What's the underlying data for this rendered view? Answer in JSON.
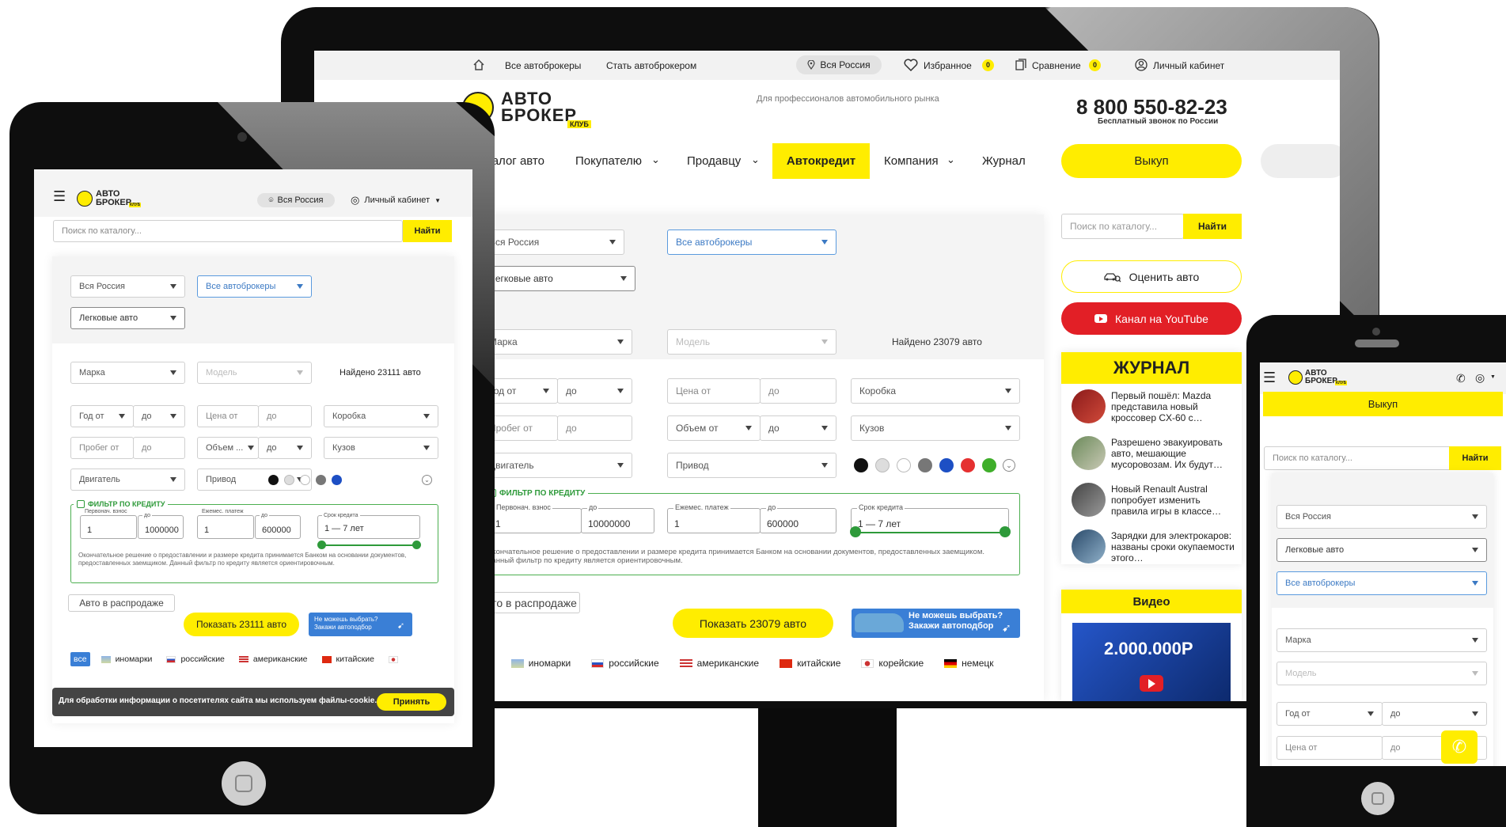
{
  "desktop": {
    "topbar": {
      "all_brokers": "Все автоброкеры",
      "become_broker": "Стать автоброкером",
      "region": "Вся Россия",
      "favorites": "Избранное",
      "favorites_count": "0",
      "compare": "Сравнение",
      "compare_count": "0",
      "account": "Личный кабинет"
    },
    "logo": {
      "line1": "АВТО",
      "line2": "БРОКЕР",
      "tag": "КЛУБ"
    },
    "tagline": "Для профессионалов автомобильного рынка",
    "phone": "8 800 550-82-23",
    "phone_note": "Бесплатный звонок по России",
    "menu": {
      "catalog": "талог авто",
      "buyer": "Покупателю",
      "seller": "Продавцу",
      "credit": "Автокредит",
      "company": "Компания",
      "journal": "Журнал",
      "buyout": "Выкуп"
    },
    "filters": {
      "region": "Вся Россия",
      "brokers": "Все автоброкеры",
      "vehicle_type": "Легковые авто",
      "make": "Марка",
      "model": "Модель",
      "found": "Найдено 23079 авто",
      "year_from": "Год от",
      "to": "до",
      "price_from": "Цена от",
      "gearbox": "Коробка",
      "mileage_from": "Пробег от",
      "volume_from": "Объем от",
      "body": "Кузов",
      "engine": "Двигатель",
      "drive": "Привод"
    },
    "credit": {
      "title": "ФИЛЬТР ПО КРЕДИТУ",
      "down_label": "Первонач. взнос",
      "down_value": "1",
      "down_to_label": "до",
      "down_to_value": "10000000",
      "monthly_label": "Ежемес. платеж",
      "monthly_value": "1",
      "monthly_to_label": "до",
      "monthly_to_value": "600000",
      "term_label": "Срок кредита",
      "term_value": "1 — 7 лет",
      "note": "Окончательное решение о предоставлении и размере кредита принимается Банком на основании документов, предоставленных заемщиком. Данный фильтр по кредиту является ориентировочным."
    },
    "sale_button": "вто в распродаже",
    "show_button": "Показать 23079 авто",
    "promo_line1": "Не можешь выбрать?",
    "promo_line2": "Закажи автоподбор",
    "tabs": [
      "се",
      "иномарки",
      "российские",
      "американские",
      "китайские",
      "корейские",
      "немецк"
    ],
    "sidebar": {
      "search_placeholder": "Поиск по каталогу...",
      "search_button": "Найти",
      "evaluate": "Оценить авто",
      "youtube": "Канал на YouTube",
      "journal_title": "ЖУРНАЛ",
      "news": [
        "Первый пошёл: Mazda представила новый кроссовер CX-60 с…",
        "Разрешено эвакуировать авто, мешающие мусоровозам. Их будут…",
        "Новый Renault Austral попробует изменить правила игры в классе…",
        "Зарядки для электрокаров: названы сроки окупаемости этого…"
      ],
      "video_title": "Видео",
      "video_caption": "2.000.000Р"
    },
    "colors": [
      "#111111",
      "#dddddd",
      "#ffffff",
      "#777777",
      "#1d4fc4",
      "#e53030",
      "#3fae2a"
    ]
  },
  "tablet": {
    "logo": {
      "line1": "АВТО",
      "line2": "БРОКЕР",
      "tag": "КЛУБ"
    },
    "region": "Вся Россия",
    "account": "Личный кабинет",
    "search_placeholder": "Поиск по каталогу...",
    "search_button": "Найти",
    "filters": {
      "region": "Вся Россия",
      "brokers": "Все автоброкеры",
      "vehicle_type": "Легковые авто",
      "make": "Марка",
      "model": "Модель",
      "found": "Найдено 23111 авто",
      "year_from": "Год от",
      "to": "до",
      "price_from": "Цена от",
      "gearbox": "Коробка",
      "mileage_from": "Пробег от",
      "volume_from": "Объем ...",
      "body": "Кузов",
      "engine": "Двигатель",
      "drive": "Привод"
    },
    "credit": {
      "title": "ФИЛЬТР ПО КРЕДИТУ",
      "down_label": "Первонач. взнос",
      "down_value": "1",
      "down_to_label": "до",
      "down_to_value": "1000000",
      "monthly_label": "Ежемес. платеж",
      "monthly_value": "1",
      "monthly_to_label": "до",
      "monthly_to_value": "600000",
      "term_label": "Срок кредита",
      "term_value": "1 — 7 лет",
      "note": "Окончательное решение о предоставлении и размере кредита принимается Банком на основании документов, предоставленных заемщиком. Данный фильтр по кредиту является ориентировочным."
    },
    "sale_button": "Авто в распродаже",
    "show_button": "Показать 23111 авто",
    "promo_line1": "Не можешь выбрать?",
    "promo_line2": "Закажи автоподбор",
    "tabs": [
      "все",
      "иномарки",
      "российские",
      "американские",
      "китайские"
    ],
    "cookie_text": "Для обработки информации о посетителях сайта мы используем файлы-cookie.",
    "cookie_accept": "Принять"
  },
  "phone": {
    "logo": {
      "line1": "АВТО",
      "line2": "БРОКЕР",
      "tag": "КЛУБ"
    },
    "buyout": "Выкуп",
    "search_placeholder": "Поиск по каталогу...",
    "search_button": "Найти",
    "filters": {
      "region": "Вся Россия",
      "vehicle_type": "Легковые авто",
      "brokers": "Все автоброкеры",
      "make": "Марка",
      "model": "Модель",
      "year_from": "Год от",
      "to": "до",
      "price_from": "Цена от",
      "to2": "до"
    }
  }
}
